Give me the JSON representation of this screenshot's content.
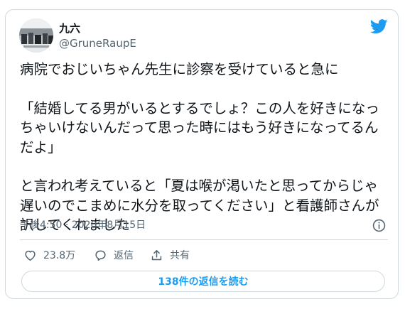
{
  "author": {
    "display_name": "九六",
    "handle": "@GruneRaupE",
    "avatar_icon": "profile-photo"
  },
  "tweet": {
    "text": "病院でおじいちゃん先生に診察を受けていると急に\n\n「結婚してる男がいるとするでしょ？この人を好きになっちゃいけないんだって思った時にはもう好きになってるんだよ」\n\nと言われ考えていると「夏は喉が渇いたと思ってからじゃ遅いのでこまめに水分を取ってください」と看護師さんが訳してくれました",
    "timestamp": "午後4:50 · 2020年8月15日"
  },
  "actions": {
    "like_count": "23.8万",
    "reply_label": "返信",
    "share_label": "共有"
  },
  "replies_button_label": "138件の返信を読む",
  "colors": {
    "brand": "#1d9bf0",
    "secondary_text": "#536471",
    "border": "#cfd9de"
  },
  "icons": {
    "logo": "twitter-bird-icon",
    "info": "info-icon",
    "like": "heart-icon",
    "reply": "reply-bubble-icon",
    "share": "share-icon"
  }
}
